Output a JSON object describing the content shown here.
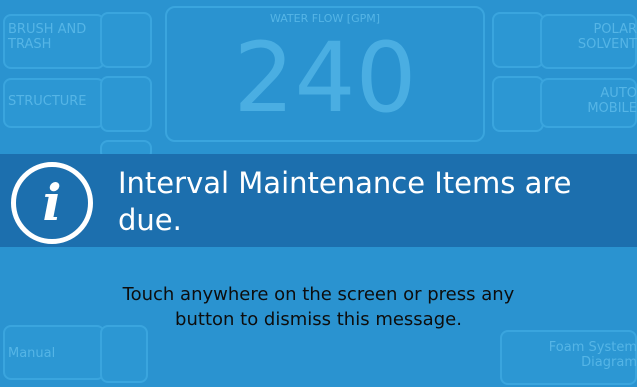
{
  "background_tiles": {
    "brush_and_trash": "BRUSH AND\nTRASH",
    "structure": "STRUCTURE",
    "polar_solvent": "POLAR\nSOLVENT",
    "automobile": "AUTO\nMOBILE",
    "manual": "Manual",
    "foam_system_diagram": "Foam System\nDiagram"
  },
  "gauge": {
    "title": "WATER FLOW [GPM]",
    "value": "240"
  },
  "alert": {
    "message": "Interval Maintenance Items are due.",
    "dismiss_text": "Touch anywhere on the screen or press any button to dismiss this message."
  },
  "colors": {
    "background": "#2a93d0",
    "banner": "#1c6fae",
    "text_light": "#ffffff",
    "text_dark": "#0d0d0d"
  }
}
